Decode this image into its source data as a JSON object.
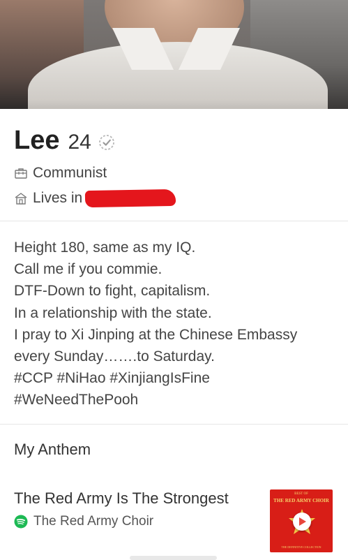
{
  "profile": {
    "name": "Lee",
    "age": "24",
    "job": "Communist",
    "lives_prefix": "Lives in"
  },
  "bio": [
    "Height 180, same as my IQ.",
    "Call me if you commie.",
    "DTF-Down to fight, capitalism.",
    "In a relationship with the state.",
    "I pray to Xi Jinping at the Chinese Embassy",
    "every Sunday…….to Saturday.",
    "#CCP #NiHao #XinjiangIsFine",
    "#WeNeedThePooh"
  ],
  "anthem": {
    "heading": "My Anthem",
    "song_title": "The Red Army Is The Strongest",
    "artist": "The Red Army Choir",
    "album_top": "BEST OF",
    "album_title": "THE RED ARMY CHOIR",
    "album_bottom": "THE DEFINITIVE COLLECTION"
  },
  "icons": {
    "verified": "verified-check-icon",
    "job": "briefcase-icon",
    "lives": "home-icon",
    "music": "spotify-icon",
    "play": "play-icon"
  },
  "colors": {
    "redaction": "#e4161c",
    "spotify": "#1db954",
    "album": "#d81e17",
    "play": "#e8453c"
  }
}
